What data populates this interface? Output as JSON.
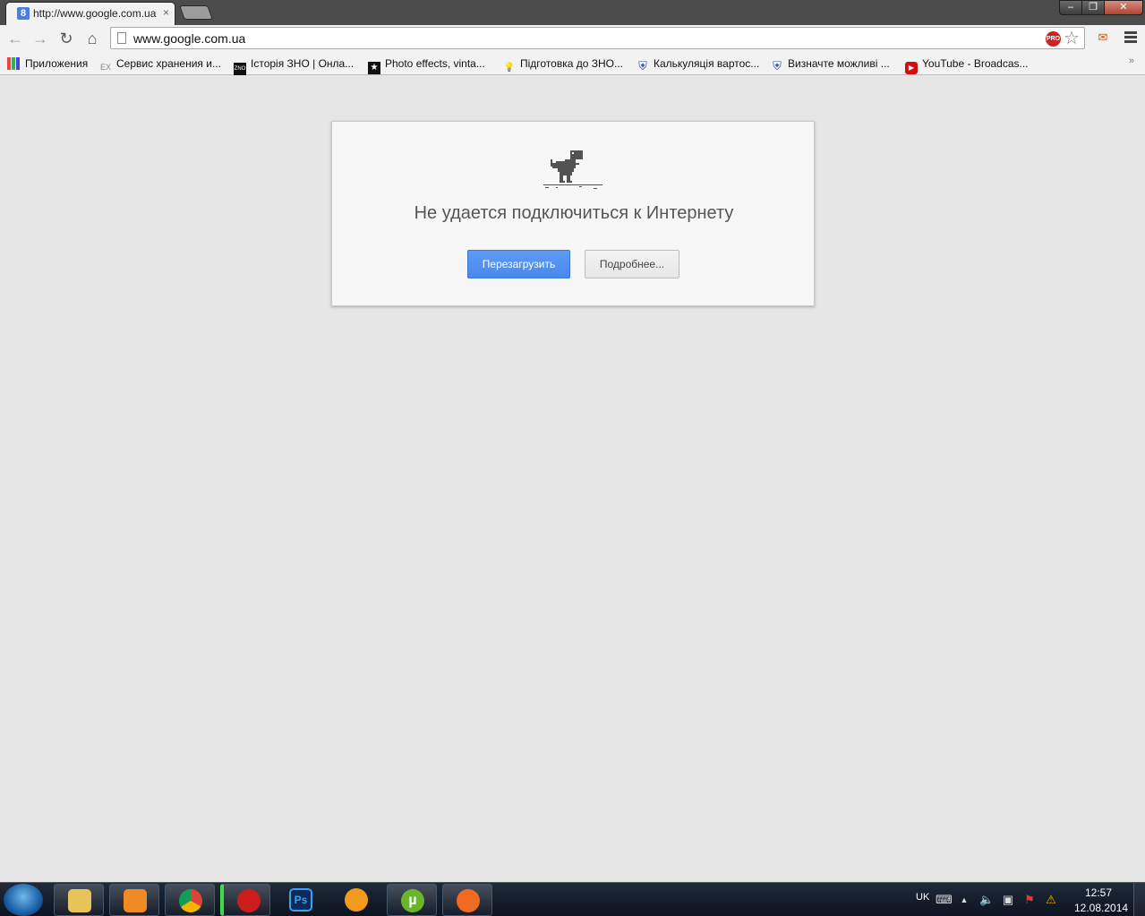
{
  "window": {
    "tab_title": "http://www.google.com.ua",
    "tab_favicon": "8",
    "tab_close": "×",
    "minimize": "–",
    "maximize": "❐",
    "close": "✕"
  },
  "toolbar": {
    "back": "←",
    "forward": "→",
    "reload": "↻",
    "home": "⌂",
    "url": "www.google.com.ua",
    "pro_badge": "PRO",
    "star": "☆"
  },
  "bookmarks": [
    {
      "label": "Приложения",
      "icon": "apps-icon"
    },
    {
      "label": "Сервис хранения и...",
      "icon": "ex-icon",
      "glyph": "EX"
    },
    {
      "label": "Історія ЗНО | Онла...",
      "icon": "zno-icon",
      "glyph": "ZNO"
    },
    {
      "label": "Photo effects, vinta...",
      "icon": "star-badge-icon",
      "glyph": "★"
    },
    {
      "label": "Підготовка до ЗНО...",
      "icon": "lightbulb-icon",
      "glyph": "💡"
    },
    {
      "label": "Калькуляція вартос...",
      "icon": "shield-icon",
      "glyph": "⛨"
    },
    {
      "label": "Визначте можливі ...",
      "icon": "shield-icon",
      "glyph": "⛨"
    },
    {
      "label": "YouTube - Broadcas...",
      "icon": "youtube-icon",
      "glyph": "▶"
    }
  ],
  "bookmarks_more": "»",
  "error": {
    "title": "Не удается подключиться к Интернету",
    "reload_button": "Перезагрузить",
    "details_button": "Подробнее..."
  },
  "taskbar": {
    "apps": [
      {
        "name": "explorer",
        "color": "#e8c35a"
      },
      {
        "name": "media-player",
        "color": "#f08a24"
      },
      {
        "name": "chrome",
        "color": "#2d9f48"
      },
      {
        "name": "opera",
        "color": "#cc1c1c"
      },
      {
        "name": "photoshop",
        "color": "#0b2a5a"
      },
      {
        "name": "aimp",
        "color": "#f29a1e"
      },
      {
        "name": "utorrent",
        "color": "#69b62d"
      },
      {
        "name": "origin",
        "color": "#f16a22"
      }
    ],
    "lang": "UK",
    "time": "12:57",
    "date": "12.08.2014"
  }
}
